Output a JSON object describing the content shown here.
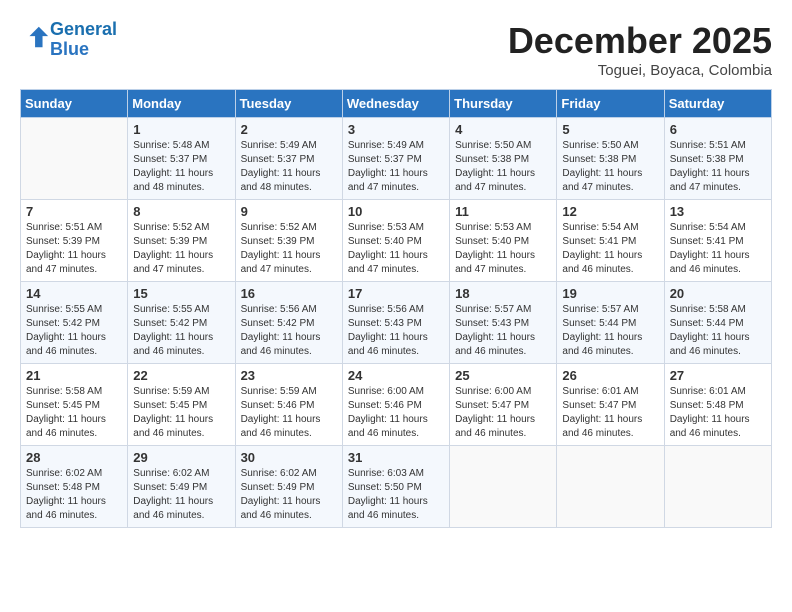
{
  "header": {
    "logo_line1": "General",
    "logo_line2": "Blue",
    "month": "December 2025",
    "location": "Toguei, Boyaca, Colombia"
  },
  "weekdays": [
    "Sunday",
    "Monday",
    "Tuesday",
    "Wednesday",
    "Thursday",
    "Friday",
    "Saturday"
  ],
  "weeks": [
    [
      {
        "day": "",
        "content": ""
      },
      {
        "day": "1",
        "content": "Sunrise: 5:48 AM\nSunset: 5:37 PM\nDaylight: 11 hours\nand 48 minutes."
      },
      {
        "day": "2",
        "content": "Sunrise: 5:49 AM\nSunset: 5:37 PM\nDaylight: 11 hours\nand 48 minutes."
      },
      {
        "day": "3",
        "content": "Sunrise: 5:49 AM\nSunset: 5:37 PM\nDaylight: 11 hours\nand 47 minutes."
      },
      {
        "day": "4",
        "content": "Sunrise: 5:50 AM\nSunset: 5:38 PM\nDaylight: 11 hours\nand 47 minutes."
      },
      {
        "day": "5",
        "content": "Sunrise: 5:50 AM\nSunset: 5:38 PM\nDaylight: 11 hours\nand 47 minutes."
      },
      {
        "day": "6",
        "content": "Sunrise: 5:51 AM\nSunset: 5:38 PM\nDaylight: 11 hours\nand 47 minutes."
      }
    ],
    [
      {
        "day": "7",
        "content": "Sunrise: 5:51 AM\nSunset: 5:39 PM\nDaylight: 11 hours\nand 47 minutes."
      },
      {
        "day": "8",
        "content": "Sunrise: 5:52 AM\nSunset: 5:39 PM\nDaylight: 11 hours\nand 47 minutes."
      },
      {
        "day": "9",
        "content": "Sunrise: 5:52 AM\nSunset: 5:39 PM\nDaylight: 11 hours\nand 47 minutes."
      },
      {
        "day": "10",
        "content": "Sunrise: 5:53 AM\nSunset: 5:40 PM\nDaylight: 11 hours\nand 47 minutes."
      },
      {
        "day": "11",
        "content": "Sunrise: 5:53 AM\nSunset: 5:40 PM\nDaylight: 11 hours\nand 47 minutes."
      },
      {
        "day": "12",
        "content": "Sunrise: 5:54 AM\nSunset: 5:41 PM\nDaylight: 11 hours\nand 46 minutes."
      },
      {
        "day": "13",
        "content": "Sunrise: 5:54 AM\nSunset: 5:41 PM\nDaylight: 11 hours\nand 46 minutes."
      }
    ],
    [
      {
        "day": "14",
        "content": "Sunrise: 5:55 AM\nSunset: 5:42 PM\nDaylight: 11 hours\nand 46 minutes."
      },
      {
        "day": "15",
        "content": "Sunrise: 5:55 AM\nSunset: 5:42 PM\nDaylight: 11 hours\nand 46 minutes."
      },
      {
        "day": "16",
        "content": "Sunrise: 5:56 AM\nSunset: 5:42 PM\nDaylight: 11 hours\nand 46 minutes."
      },
      {
        "day": "17",
        "content": "Sunrise: 5:56 AM\nSunset: 5:43 PM\nDaylight: 11 hours\nand 46 minutes."
      },
      {
        "day": "18",
        "content": "Sunrise: 5:57 AM\nSunset: 5:43 PM\nDaylight: 11 hours\nand 46 minutes."
      },
      {
        "day": "19",
        "content": "Sunrise: 5:57 AM\nSunset: 5:44 PM\nDaylight: 11 hours\nand 46 minutes."
      },
      {
        "day": "20",
        "content": "Sunrise: 5:58 AM\nSunset: 5:44 PM\nDaylight: 11 hours\nand 46 minutes."
      }
    ],
    [
      {
        "day": "21",
        "content": "Sunrise: 5:58 AM\nSunset: 5:45 PM\nDaylight: 11 hours\nand 46 minutes."
      },
      {
        "day": "22",
        "content": "Sunrise: 5:59 AM\nSunset: 5:45 PM\nDaylight: 11 hours\nand 46 minutes."
      },
      {
        "day": "23",
        "content": "Sunrise: 5:59 AM\nSunset: 5:46 PM\nDaylight: 11 hours\nand 46 minutes."
      },
      {
        "day": "24",
        "content": "Sunrise: 6:00 AM\nSunset: 5:46 PM\nDaylight: 11 hours\nand 46 minutes."
      },
      {
        "day": "25",
        "content": "Sunrise: 6:00 AM\nSunset: 5:47 PM\nDaylight: 11 hours\nand 46 minutes."
      },
      {
        "day": "26",
        "content": "Sunrise: 6:01 AM\nSunset: 5:47 PM\nDaylight: 11 hours\nand 46 minutes."
      },
      {
        "day": "27",
        "content": "Sunrise: 6:01 AM\nSunset: 5:48 PM\nDaylight: 11 hours\nand 46 minutes."
      }
    ],
    [
      {
        "day": "28",
        "content": "Sunrise: 6:02 AM\nSunset: 5:48 PM\nDaylight: 11 hours\nand 46 minutes."
      },
      {
        "day": "29",
        "content": "Sunrise: 6:02 AM\nSunset: 5:49 PM\nDaylight: 11 hours\nand 46 minutes."
      },
      {
        "day": "30",
        "content": "Sunrise: 6:02 AM\nSunset: 5:49 PM\nDaylight: 11 hours\nand 46 minutes."
      },
      {
        "day": "31",
        "content": "Sunrise: 6:03 AM\nSunset: 5:50 PM\nDaylight: 11 hours\nand 46 minutes."
      },
      {
        "day": "",
        "content": ""
      },
      {
        "day": "",
        "content": ""
      },
      {
        "day": "",
        "content": ""
      }
    ]
  ]
}
